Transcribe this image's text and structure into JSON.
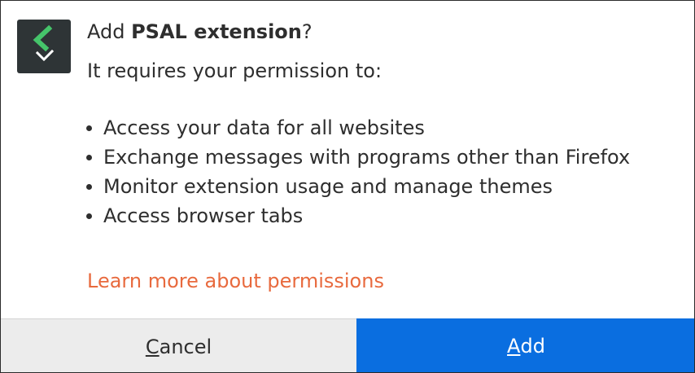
{
  "dialog": {
    "title_prefix": "Add ",
    "extension_name": "PSAL extension",
    "title_suffix": "?",
    "subtitle": "It requires your permission to:",
    "permissions": [
      "Access your data for all websites",
      "Exchange messages with programs other than Firefox",
      "Monitor extension usage and manage themes",
      "Access browser tabs"
    ],
    "learn_more": "Learn more about permissions",
    "icon": "psal-extension-icon"
  },
  "buttons": {
    "cancel_mnemonic": "C",
    "cancel_rest": "ancel",
    "add_mnemonic": "A",
    "add_rest": "dd"
  },
  "colors": {
    "link": "#e86a3e",
    "primary_button": "#0a6ee0",
    "secondary_button": "#ececec",
    "icon_background": "#2e3436",
    "icon_accent": "#45c46a"
  }
}
